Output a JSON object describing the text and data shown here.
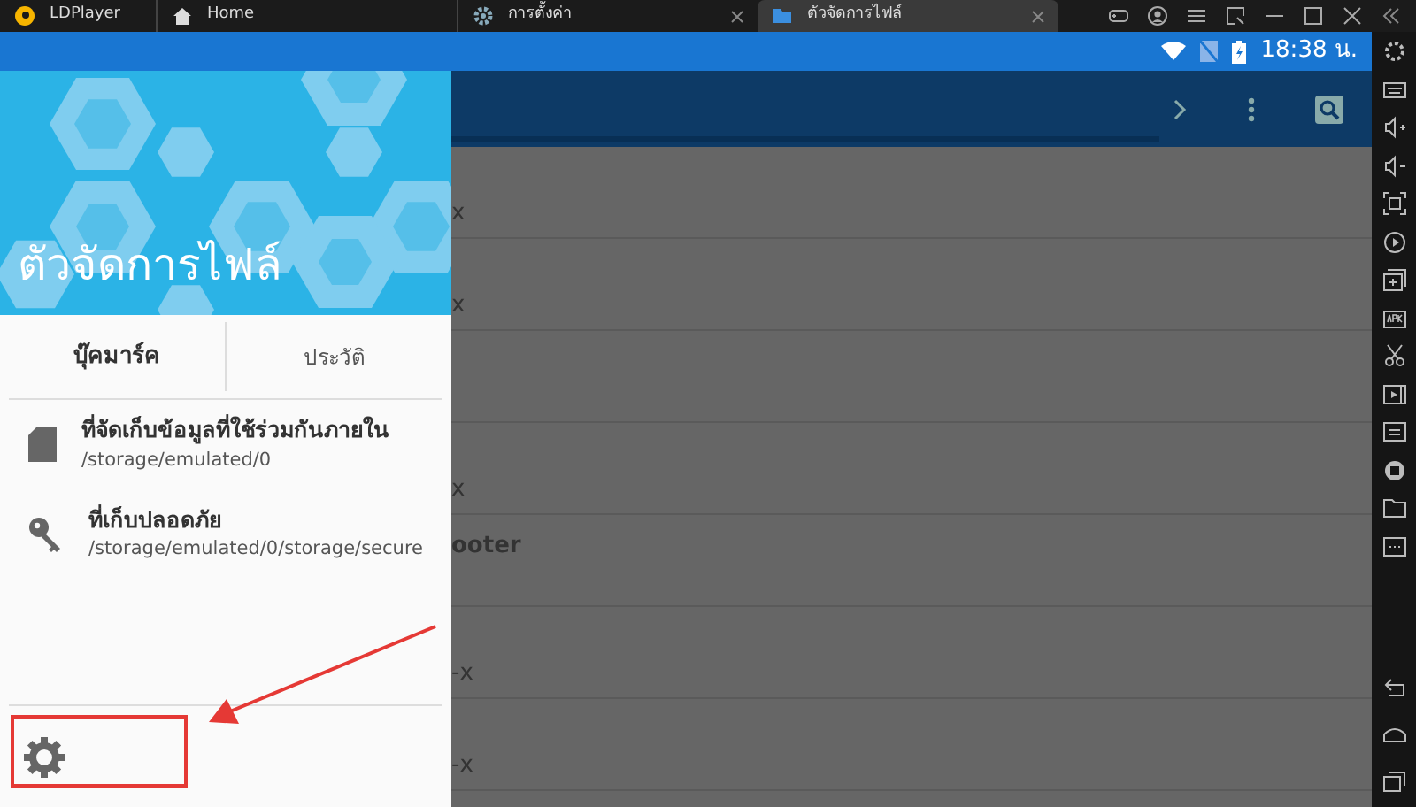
{
  "title_bar": {
    "tabs": [
      {
        "label": "LDPlayer",
        "kind": "app",
        "selected": false,
        "closable": false
      },
      {
        "label": "Home",
        "kind": "home",
        "selected": false,
        "closable": false
      },
      {
        "label": "การตั้งค่า",
        "kind": "settings",
        "selected": false,
        "closable": true
      },
      {
        "label": "ตัวจัดการไฟล์",
        "kind": "folder",
        "selected": true,
        "closable": true
      }
    ]
  },
  "status_bar": {
    "time": "18:38 น."
  },
  "drawer": {
    "title": "ตัวจัดการไฟล์",
    "tabs": [
      {
        "label": "บุ๊คมาร์ค",
        "selected": true
      },
      {
        "label": "ประวัติ",
        "selected": false
      }
    ],
    "locations": [
      {
        "kind": "sd-card",
        "name": "ที่จัดเก็บข้อมูลที่ใช้ร่วมกันภายใน",
        "path": "/storage/emulated/0"
      },
      {
        "kind": "key",
        "name": "ที่เก็บปลอดภัย",
        "path": "/storage/emulated/0/storage/secure"
      }
    ]
  },
  "background_list": {
    "rows": [
      {
        "kind": "subtitle",
        "text": "x"
      },
      {
        "kind": "subtitle",
        "text": "x"
      },
      {
        "kind": "blank"
      },
      {
        "kind": "subtitle",
        "text": "x"
      },
      {
        "kind": "title",
        "text": "ooter"
      },
      {
        "kind": "subtitle",
        "text": "-x"
      },
      {
        "kind": "subtitle",
        "text": "-x"
      }
    ]
  }
}
